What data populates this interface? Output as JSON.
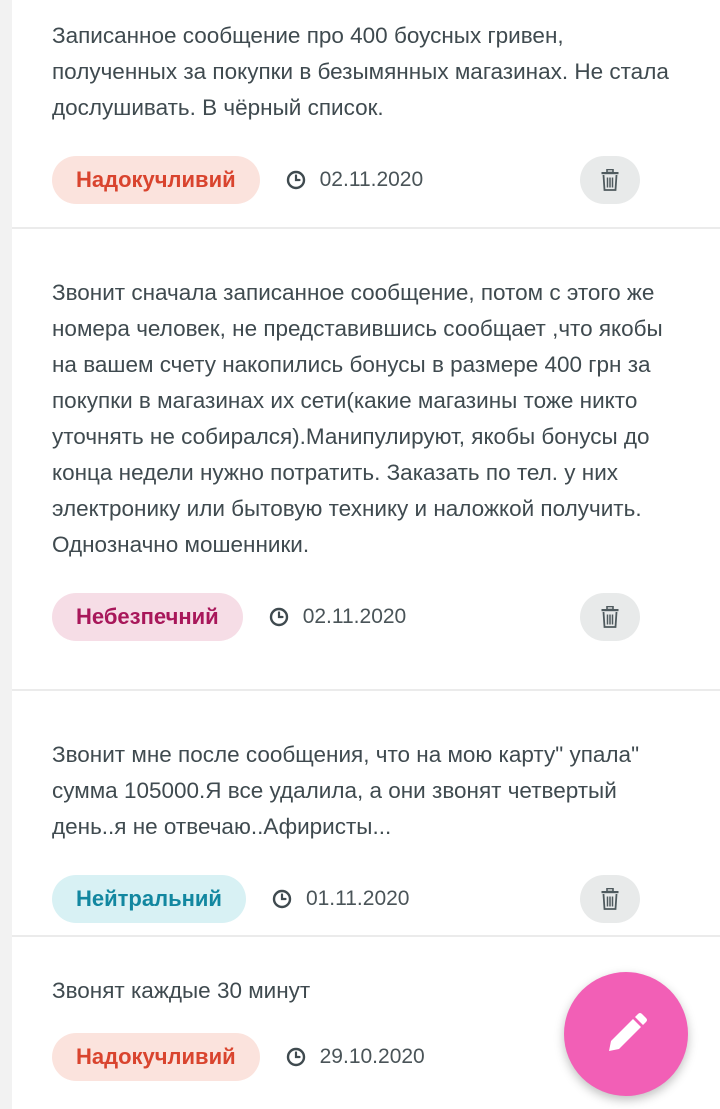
{
  "theme": {
    "fab_color": "#f25fb6",
    "badge_annoying": {
      "bg": "#fbe3dd",
      "fg": "#d9442e"
    },
    "badge_dangerous": {
      "bg": "#f6dde6",
      "fg": "#a8175a"
    },
    "badge_neutral": {
      "bg": "#d8f1f4",
      "fg": "#1287a0"
    }
  },
  "reviews": [
    {
      "text": "Записанное сообщение про 400 боусных гривен, полученных за покупки в безымянных магазинах. Не стала дослушивать. В чёрный список.",
      "badge": "Надокучливий",
      "badge_type": "annoying",
      "date": "02.11.2020"
    },
    {
      "text": "Звонит сначала записанное сообщение, потом с этого же номера человек, не представившись сообщает ,что якобы на вашем счету накопились бонусы в размере 400 грн за покупки в магазинах их сети(какие магазины тоже никто уточнять не собирался).Манипулируют, якобы бонусы до конца недели нужно потратить. Заказать по тел. у них электронику или бытовую технику и наложкой получить. Однозначно мошенники.",
      "badge": "Небезпечний",
      "badge_type": "dangerous",
      "date": "02.11.2020"
    },
    {
      "text": "Звонит мне после сообщения, что на мою карту\" упала\" сумма 105000.Я все удалила, а они звонят четвертый день..я не отвечаю..Афиристы...",
      "badge": "Нейтральний",
      "badge_type": "neutral",
      "date": "01.11.2020"
    },
    {
      "text": "Звонят каждые 30 минут",
      "badge": "Надокучливий",
      "badge_type": "annoying",
      "date": "29.10.2020"
    }
  ]
}
